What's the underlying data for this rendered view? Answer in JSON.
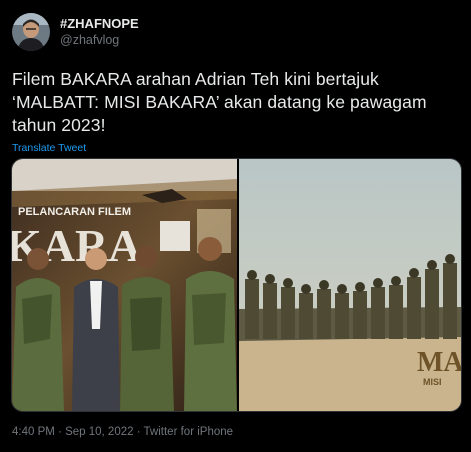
{
  "user": {
    "display_name": "#ZHAFNOPE",
    "handle": "@zhafvlog"
  },
  "tweet": {
    "text": "Filem BAKARA arahan Adrian Teh kini bertajuk ‘MALBATT: MISI BAKARA’ akan datang ke pawagam tahun 2023!",
    "translate_label": "Translate Tweet"
  },
  "media": {
    "left_photo": {
      "banner_text": "PELANCARAN FILEM",
      "title_fragment": "KARA"
    },
    "right_photo": {
      "title_fragment": "MAL",
      "subtitle_fragment": "MISI"
    }
  },
  "meta": {
    "time": "4:40 PM",
    "date": "Sep 10, 2022",
    "source": "Twitter for iPhone",
    "separator": "·"
  },
  "colors": {
    "background": "#000000",
    "text": "#e7e9ea",
    "muted": "#71767b",
    "link": "#1d9bf0"
  }
}
